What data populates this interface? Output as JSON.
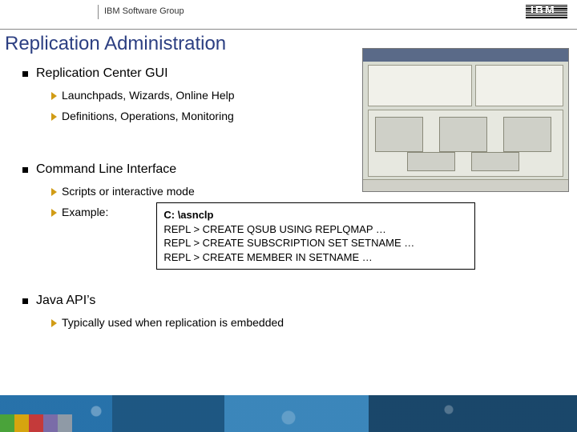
{
  "header": {
    "group_label": "IBM Software Group",
    "logo_text": "IBM"
  },
  "title": "Replication Administration",
  "sections": [
    {
      "heading": "Replication Center GUI",
      "items": [
        "Launchpads, Wizards, Online Help",
        "Definitions, Operations, Monitoring"
      ]
    },
    {
      "heading": "Command Line Interface",
      "items": [
        "Scripts or interactive mode",
        "Example:"
      ]
    },
    {
      "heading": "Java API’s",
      "items": [
        "Typically used when replication is embedded"
      ]
    }
  ],
  "code": {
    "line1": "C: \\asnclp",
    "line2": "REPL > CREATE QSUB USING REPLQMAP …",
    "line3": "REPL > CREATE SUBSCRIPTION SET SETNAME …",
    "line4": "REPL > CREATE MEMBER IN SETNAME …"
  }
}
